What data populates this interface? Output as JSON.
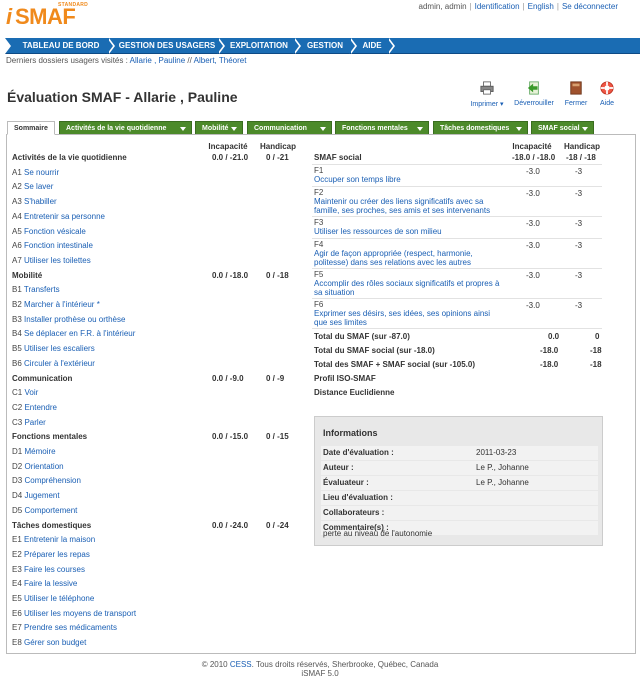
{
  "header": {
    "logo_i": "i",
    "logo_smaf": "SMAF",
    "logo_std": "STANDARD",
    "user": "admin, admin",
    "identification": "Identification",
    "language": "English",
    "logout": "Se déconnecter",
    "separator": "|"
  },
  "nav": {
    "items": [
      "TABLEAU DE BORD",
      "GESTION DES USAGERS",
      "EXPLOITATION",
      "GESTION",
      "AIDE"
    ]
  },
  "recent": {
    "label": "Derniers dossiers usagers visités : ",
    "link1": "Allarie , Pauline",
    "sep": " // ",
    "link2": "Albert, Théoret"
  },
  "page": {
    "title": "Évaluation SMAF - Allarie , Pauline",
    "tools": {
      "print": "Imprimer",
      "collapse": "Déverrouiller",
      "close": "Fermer",
      "help": "Aide"
    }
  },
  "tabs": [
    "Sommaire",
    "Activités de la vie quotidienne",
    "Mobilité",
    "Communication",
    "Fonctions mentales",
    "Tâches domestiques",
    "SMAF social"
  ],
  "left": {
    "col_incap": "Incapacité",
    "col_handi": "Handicap",
    "sections": [
      {
        "title": "Activités de la vie quotidienne",
        "incap": "0.0 / -21.0",
        "handi": "0 / -21",
        "items": [
          [
            "A1",
            "Se nourrir"
          ],
          [
            "A2",
            "Se laver"
          ],
          [
            "A3",
            "S'habiller"
          ],
          [
            "A4",
            "Entretenir sa personne"
          ],
          [
            "A5",
            "Fonction vésicale"
          ],
          [
            "A6",
            "Fonction intestinale"
          ],
          [
            "A7",
            "Utiliser les toilettes"
          ]
        ]
      },
      {
        "title": "Mobilité",
        "incap": "0.0 / -18.0",
        "handi": "0 / -18",
        "items": [
          [
            "B1",
            "Transferts"
          ],
          [
            "B2",
            "Marcher à l'intérieur *"
          ],
          [
            "B3",
            "Installer prothèse ou orthèse"
          ],
          [
            "B4",
            "Se déplacer en F.R. à l'intérieur"
          ],
          [
            "B5",
            "Utiliser les escaliers"
          ],
          [
            "B6",
            "Circuler à l'extérieur"
          ]
        ]
      },
      {
        "title": "Communication",
        "incap": "0.0 / -9.0",
        "handi": "0 / -9",
        "items": [
          [
            "C1",
            "Voir"
          ],
          [
            "C2",
            "Entendre"
          ],
          [
            "C3",
            "Parler"
          ]
        ]
      },
      {
        "title": "Fonctions mentales",
        "incap": "0.0 / -15.0",
        "handi": "0 / -15",
        "items": [
          [
            "D1",
            "Mémoire"
          ],
          [
            "D2",
            "Orientation"
          ],
          [
            "D3",
            "Compréhension"
          ],
          [
            "D4",
            "Jugement"
          ],
          [
            "D5",
            "Comportement"
          ]
        ]
      },
      {
        "title": "Tâches domestiques",
        "incap": "0.0 / -24.0",
        "handi": "0 / -24",
        "items": [
          [
            "E1",
            "Entretenir la maison"
          ],
          [
            "E2",
            "Préparer les repas"
          ],
          [
            "E3",
            "Faire les courses"
          ],
          [
            "E4",
            "Faire la lessive"
          ],
          [
            "E5",
            "Utiliser le téléphone"
          ],
          [
            "E6",
            "Utiliser les moyens de transport"
          ],
          [
            "E7",
            "Prendre ses médicaments"
          ],
          [
            "E8",
            "Gérer son budget"
          ]
        ]
      }
    ]
  },
  "right": {
    "title": "SMAF social",
    "col_incap": "Incapacité",
    "col_handi": "Handicap",
    "incap": "-18.0 / -18.0",
    "handi": "-18 / -18",
    "items": [
      {
        "code": "F1",
        "label": "Occuper son temps libre",
        "incap": "-3.0",
        "handi": "-3"
      },
      {
        "code": "F2",
        "label": "Maintenir ou créer des liens significatifs avec sa famille, ses proches, ses amis et ses intervenants",
        "incap": "-3.0",
        "handi": "-3"
      },
      {
        "code": "F3",
        "label": "Utiliser les ressources de son milieu",
        "incap": "-3.0",
        "handi": "-3"
      },
      {
        "code": "F4",
        "label": "Agir de façon appropriée (respect, harmonie, politesse) dans ses relations avec les autres",
        "incap": "-3.0",
        "handi": "-3"
      },
      {
        "code": "F5",
        "label": "Accomplir des rôles sociaux significatifs et propres à sa situation",
        "incap": "-3.0",
        "handi": "-3"
      },
      {
        "code": "F6",
        "label": "Exprimer ses désirs, ses idées, ses opinions ainsi que ses limites",
        "incap": "-3.0",
        "handi": "-3"
      }
    ],
    "totals": [
      {
        "label": "Total du SMAF (sur -87.0)",
        "incap": "0.0",
        "handi": "0"
      },
      {
        "label": "Total du SMAF social (sur -18.0)",
        "incap": "-18.0",
        "handi": "-18"
      },
      {
        "label": "Total des SMAF + SMAF social (sur -105.0)",
        "incap": "-18.0",
        "handi": "-18"
      },
      {
        "label": "Profil ISO-SMAF",
        "incap": "",
        "handi": ""
      },
      {
        "label": "Distance Euclidienne",
        "incap": "",
        "handi": ""
      }
    ]
  },
  "info": {
    "title": "Informations",
    "rows": [
      {
        "k": "Date d'évaluation :",
        "v": "2011-03-23"
      },
      {
        "k": "Auteur :",
        "v": "Le P., Johanne"
      },
      {
        "k": "Évaluateur :",
        "v": "Le P., Johanne"
      },
      {
        "k": "Lieu d'évaluation :",
        "v": ""
      },
      {
        "k": "Collaborateurs :",
        "v": ""
      },
      {
        "k": "Commentaire(s) :",
        "v": ""
      }
    ],
    "comment": "perte au niveau de l'autonomie"
  },
  "footer": {
    "line1_a": "© 2010 ",
    "cess": "CESS",
    "line1_b": ". Tous droits réservés, Sherbrooke, Québec, Canada",
    "line2": "iSMAF 5.0"
  }
}
